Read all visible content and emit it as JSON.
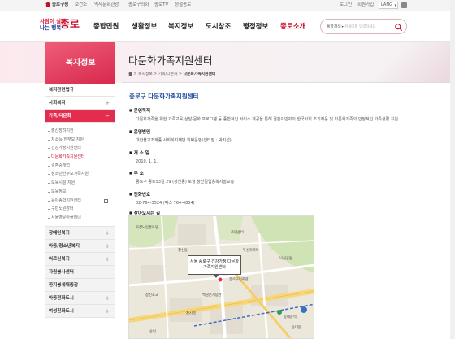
{
  "topbar": {
    "home": "종로구청",
    "links": [
      "보건소",
      "역사문화관광",
      "종로구의회",
      "종로TV",
      "정설종로"
    ],
    "login": "로그인",
    "signup": "회원가입",
    "lang": "LANG"
  },
  "header": {
    "logo_line1": "사람이 살맛",
    "logo_line2": "나는 행복",
    "logo_main": "종로",
    "nav": [
      "종합민원",
      "생활정보",
      "복지정보",
      "도시창조",
      "행정정보",
      "종로소개"
    ],
    "search_scope": "통합검색",
    "search_placeholder": "검색어를 입력하세요"
  },
  "lnb": {
    "title": "복지정보",
    "items_top": [
      "복지관련법규",
      "사회복지"
    ],
    "open_item": "가족/다문화",
    "sub_items": [
      "출산장려지원",
      "저소득 한부모 지원",
      "건강가정지원센터",
      "다문화가족지원센터",
      "결혼중개업",
      "청소년한부모가족지원",
      "보육시설 지원",
      "보육정보",
      "육아종합지원센터",
      "구민노원장터",
      "서울영유아플래너"
    ],
    "active_sub": 3,
    "external_sub": 8,
    "items_bottom": [
      "장애인복지",
      "아동/청소년복지",
      "어르신복지",
      "자원봉사센터",
      "한지봉세대종감",
      "아동전화도시",
      "여성친화도시"
    ]
  },
  "content": {
    "page_title": "다문화가족지원센터",
    "breadcrumb": [
      "복지정보",
      "가족/다문화",
      "다문화가족지원센터"
    ],
    "section_title": "종로구 다문화가족지원센터",
    "fields": [
      {
        "label": "운영목적",
        "value": "다문화가족을 위한 가족교육·상담·문화 프로그램 등 종합적인 서비스 제공을 통해 결혼이민자의 한국사회 조기적응 및 다문화가족의 안정적인 가족생활 지원"
      },
      {
        "label": "운영법인",
        "value": "대한불교조계종 사회복지재단 위탁운영(센터장 : 박지선)"
      },
      {
        "label": "개 소 일",
        "value": "2010. 1. 1."
      },
      {
        "label": "주 소",
        "value": "종로구 종로53길 29 (창신동) 토월 창신길업용복지발교층"
      },
      {
        "label": "전화번호",
        "value": "02-764-3524 (팩스 764-4854)"
      },
      {
        "label": "찾아오시는 길",
        "value": ""
      }
    ],
    "map_popup": "서울 종로구 건강가정·다문화가족지원센터",
    "map_labels": [
      "주민센터",
      "창신동",
      "두산아파트",
      "종로구민회관",
      "낙산공원",
      "동대문",
      "동대문역",
      "창신역",
      "창신초교",
      "가정노인경로당",
      "숭인",
      "백남준기념관"
    ]
  },
  "colors": {
    "brand": "#c8102e",
    "accent_blue": "#1f4a9c",
    "lnb_active": "#e22d4f"
  }
}
